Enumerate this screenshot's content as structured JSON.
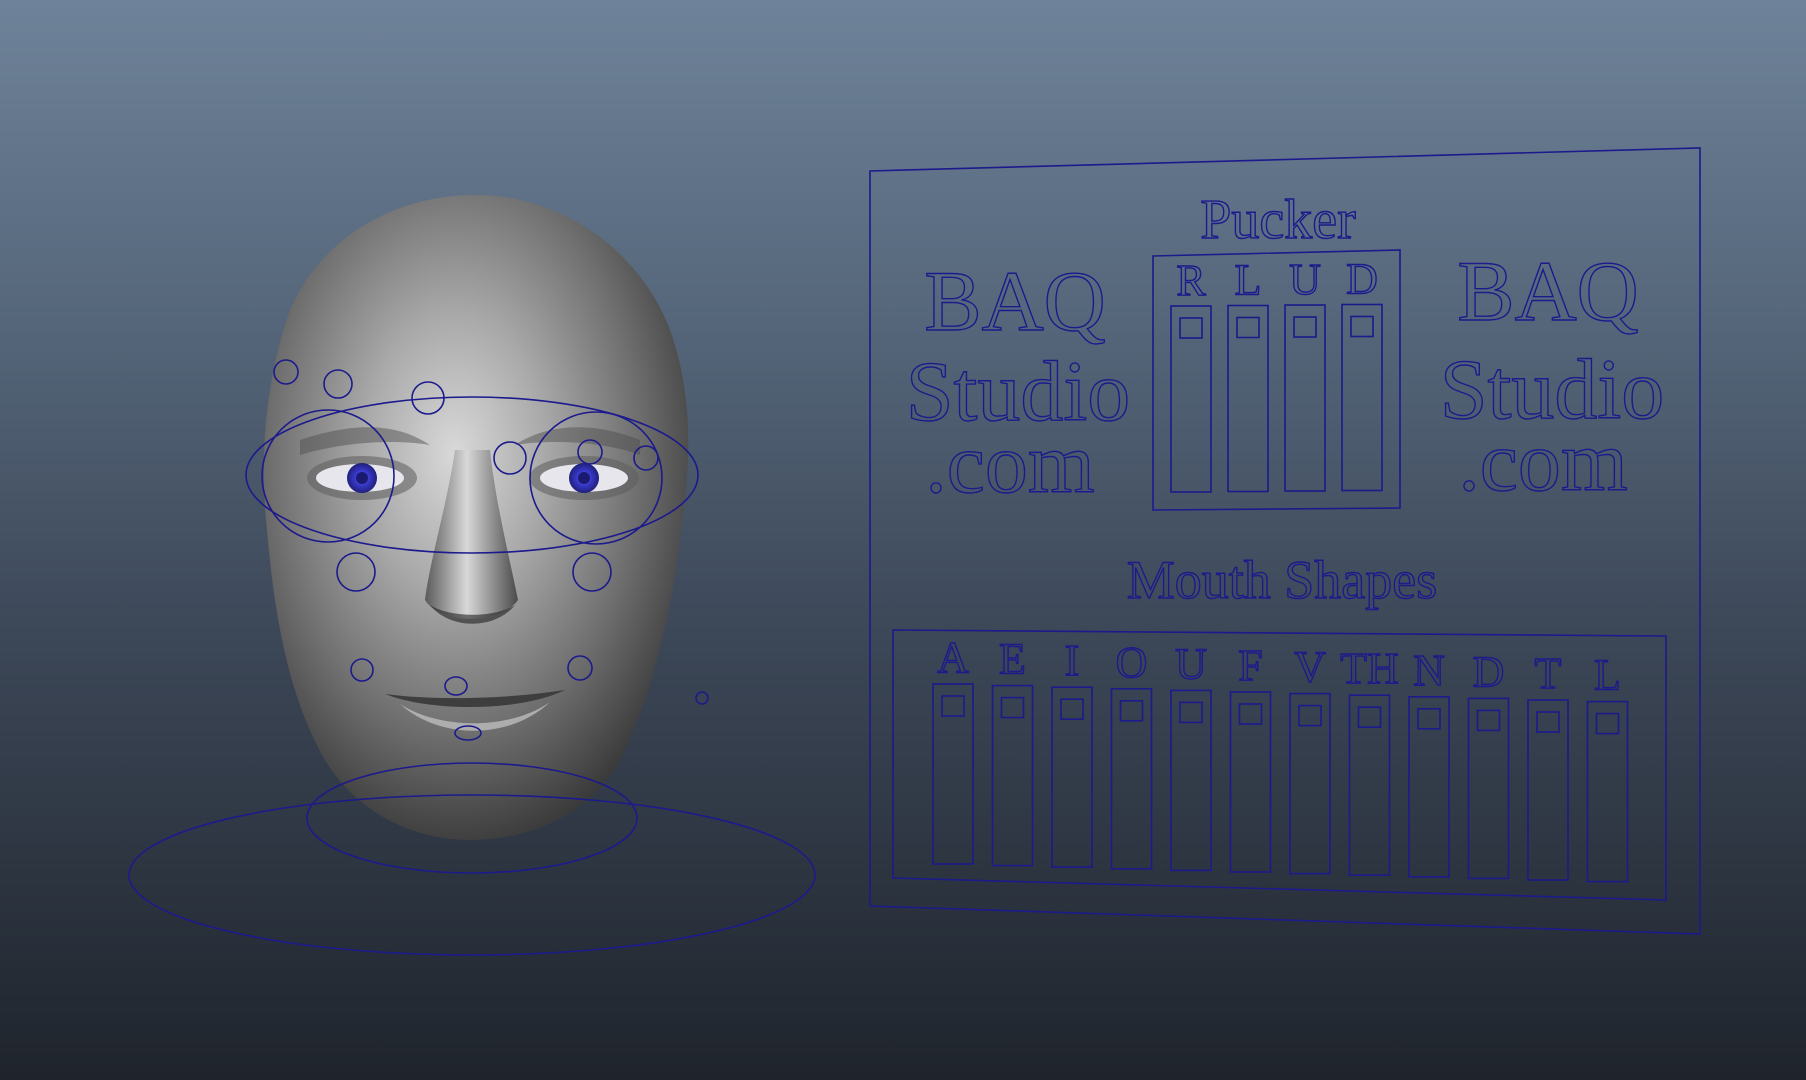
{
  "viewport": {
    "background_top": "#6e8299",
    "background_bottom": "#1f242c",
    "wire_color": "#1c1a8c",
    "eye_color": "#3a3ad0"
  },
  "control_board": {
    "pucker": {
      "title": "Pucker",
      "channels": [
        "R",
        "L",
        "U",
        "D"
      ]
    },
    "logo_left": [
      "BAQ",
      "Studio",
      ".com"
    ],
    "logo_right": [
      "BAQ",
      "Studio",
      ".com"
    ],
    "mouth_shapes": {
      "title": "Mouth Shapes",
      "channels": [
        "A",
        "E",
        "I",
        "O",
        "U",
        "F",
        "V",
        "TH",
        "N",
        "D",
        "T",
        "L"
      ]
    }
  }
}
